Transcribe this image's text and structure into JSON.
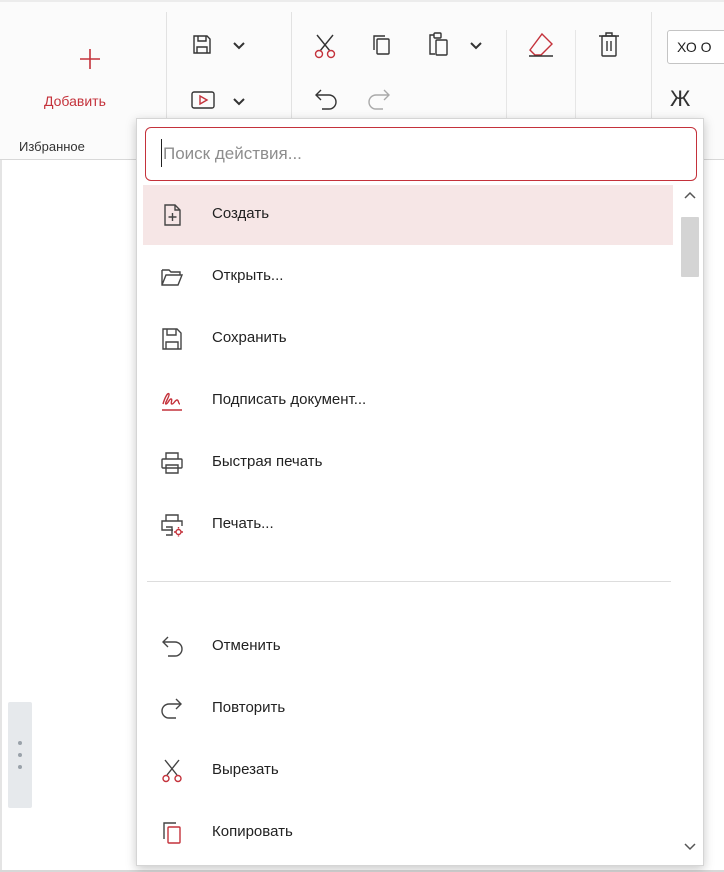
{
  "colors": {
    "accent": "#c4323b",
    "highlight": "#f6e6e6",
    "text": "#222222"
  },
  "ribbon": {
    "add_label": "Добавить",
    "favorites_group": "Избранное",
    "font_value": "ХО О",
    "bold_label": "Ж",
    "icons": [
      "save-icon",
      "dropdown-chevron-icon",
      "slideshow-icon",
      "cut-icon",
      "copy-icon",
      "paste-icon",
      "undo-icon",
      "redo-icon",
      "eraser-icon",
      "delete-icon"
    ]
  },
  "popup": {
    "search_placeholder": "Поиск действия...",
    "search_value": "",
    "items": [
      {
        "label": "Создать",
        "icon": "new-file-icon",
        "highlighted": true
      },
      {
        "label": "Открыть...",
        "icon": "folder-open-icon"
      },
      {
        "label": "Сохранить",
        "icon": "save-icon"
      },
      {
        "label": "Подписать документ...",
        "icon": "signature-icon"
      },
      {
        "label": "Быстрая печать",
        "icon": "printer-icon"
      },
      {
        "label": "Печать...",
        "icon": "print-settings-icon"
      },
      {
        "label": "Отменить",
        "icon": "undo-icon"
      },
      {
        "label": "Повторить",
        "icon": "redo-icon"
      },
      {
        "label": "Вырезать",
        "icon": "cut-icon"
      },
      {
        "label": "Копировать",
        "icon": "copy-icon"
      }
    ]
  }
}
